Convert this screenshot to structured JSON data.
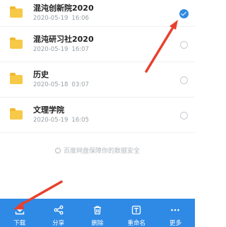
{
  "files": [
    {
      "name": "混沌创新院2020",
      "date": "2020-05-19",
      "time": "16:06",
      "selected": true
    },
    {
      "name": "混沌研习社2020",
      "date": "2020-05-19",
      "time": "16:07",
      "selected": false
    },
    {
      "name": "历史",
      "date": "2020-05-18",
      "time": "03:07",
      "selected": false
    },
    {
      "name": "文理学院",
      "date": "2020-05-19",
      "time": "16:05",
      "selected": false
    }
  ],
  "footnote": "百度网盘保障你的数据安全",
  "toolbar": {
    "download": "下载",
    "share": "分享",
    "delete": "删除",
    "rename": "重命名",
    "more": "更多"
  },
  "colors": {
    "accent": "#2f8ae5",
    "folder": "#f7c948",
    "annotation": "#e8402e"
  }
}
